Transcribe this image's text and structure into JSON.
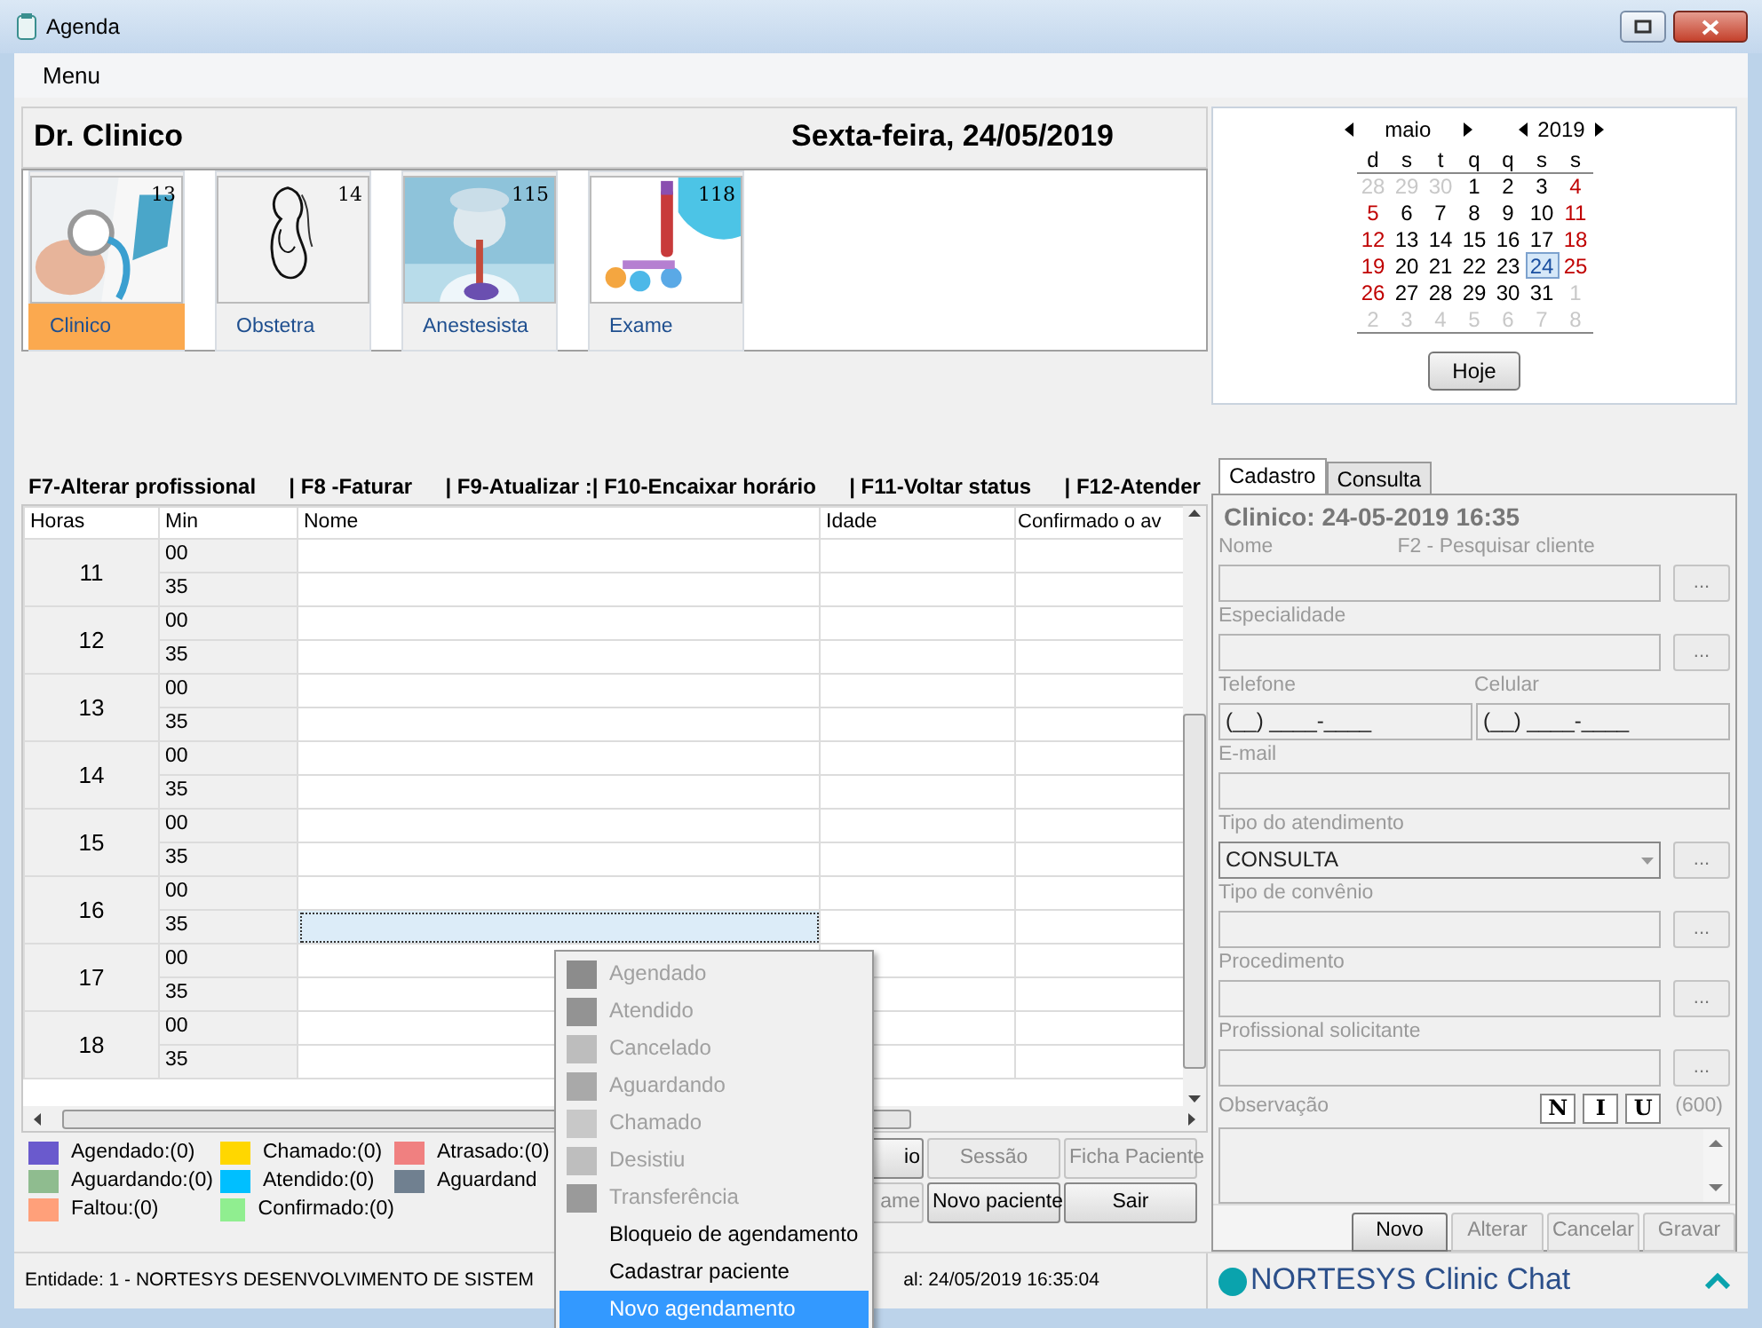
{
  "window": {
    "title": "Agenda"
  },
  "menu": [
    {
      "label": "Menu"
    }
  ],
  "header": {
    "professional": "Dr. Clinico",
    "date": "Sexta-feira, 24/05/2019"
  },
  "specialties": [
    {
      "label": "Clinico",
      "count": "13",
      "selected": true,
      "kind": "picture"
    },
    {
      "label": "Obstetra",
      "count": "14",
      "selected": false,
      "kind": "picture"
    },
    {
      "label": "Anestesista",
      "count": "115",
      "selected": false,
      "kind": "picture"
    },
    {
      "label": "Exame",
      "count": "118",
      "selected": false,
      "kind": "picture"
    }
  ],
  "shortcuts": [
    "F7-Alterar profissional",
    "| F8 -Faturar",
    "| F9-Atualizar :| F10-Encaixar horário",
    "| F11-Voltar status",
    "| F12-Atender"
  ],
  "schedule": {
    "columns": [
      "Horas",
      "Min",
      "Nome",
      "Idade",
      "Confirmado o av"
    ],
    "hours": [
      {
        "hour": "11",
        "slots": [
          {
            "min": "00",
            "selected": false
          },
          {
            "min": "35",
            "selected": false
          }
        ]
      },
      {
        "hour": "12",
        "slots": [
          {
            "min": "00",
            "selected": false
          },
          {
            "min": "35",
            "selected": false
          }
        ]
      },
      {
        "hour": "13",
        "slots": [
          {
            "min": "00",
            "selected": false
          },
          {
            "min": "35",
            "selected": false
          }
        ]
      },
      {
        "hour": "14",
        "slots": [
          {
            "min": "00",
            "selected": false
          },
          {
            "min": "35",
            "selected": false
          }
        ]
      },
      {
        "hour": "15",
        "slots": [
          {
            "min": "00",
            "selected": false
          },
          {
            "min": "35",
            "selected": false
          }
        ]
      },
      {
        "hour": "16",
        "slots": [
          {
            "min": "00",
            "selected": false
          },
          {
            "min": "35",
            "selected": true
          }
        ]
      },
      {
        "hour": "17",
        "slots": [
          {
            "min": "00",
            "selected": false
          },
          {
            "min": "35",
            "selected": false
          }
        ]
      },
      {
        "hour": "18",
        "slots": [
          {
            "min": "00",
            "selected": false
          },
          {
            "min": "35",
            "selected": false
          }
        ]
      }
    ]
  },
  "legend": [
    {
      "label": "Agendado:(0)",
      "color": "#6a5acd"
    },
    {
      "label": "Chamado:(0)",
      "color": "#ffd700"
    },
    {
      "label": "Atrasado:(0)",
      "color": "#f08080"
    },
    {
      "label": "Aguardando:(0)",
      "color": "#8fbc8f"
    },
    {
      "label": "Atendido:(0)",
      "color": "#00bfff"
    },
    {
      "label": "Aguardand",
      "color": "#708090"
    },
    {
      "label": "Faltou:(0)",
      "color": "#ffa07a"
    },
    {
      "label": "Confirmado:(0)",
      "color": "#90ee90"
    }
  ],
  "actions": [
    {
      "label": "io",
      "disabled": false
    },
    {
      "label": "Sessão",
      "disabled": true
    },
    {
      "label": "Ficha Paciente",
      "disabled": true
    },
    {
      "label": "ame",
      "disabled": true
    },
    {
      "label": "Novo paciente",
      "disabled": false
    },
    {
      "label": "Sair",
      "disabled": false
    }
  ],
  "status_bar": {
    "entity": "Entidade: 1 - NORTESYS DESENVOLVIMENTO DE SISTEM",
    "time": "al: 24/05/2019 16:35:04"
  },
  "calendar": {
    "month": "maio",
    "year": "2019",
    "weekdays": [
      "d",
      "s",
      "t",
      "q",
      "q",
      "s",
      "s"
    ],
    "weeks": [
      [
        {
          "d": "28",
          "kind": "other",
          "selected": false
        },
        {
          "d": "29",
          "kind": "other",
          "selected": false
        },
        {
          "d": "30",
          "kind": "other",
          "selected": false
        },
        {
          "d": "1",
          "kind": "weekday",
          "selected": false
        },
        {
          "d": "2",
          "kind": "weekday",
          "selected": false
        },
        {
          "d": "3",
          "kind": "weekday",
          "selected": false
        },
        {
          "d": "4",
          "kind": "weekend",
          "selected": false
        }
      ],
      [
        {
          "d": "5",
          "kind": "weekend",
          "selected": false
        },
        {
          "d": "6",
          "kind": "weekday",
          "selected": false
        },
        {
          "d": "7",
          "kind": "weekday",
          "selected": false
        },
        {
          "d": "8",
          "kind": "weekday",
          "selected": false
        },
        {
          "d": "9",
          "kind": "weekday",
          "selected": false
        },
        {
          "d": "10",
          "kind": "weekday",
          "selected": false
        },
        {
          "d": "11",
          "kind": "weekend",
          "selected": false
        }
      ],
      [
        {
          "d": "12",
          "kind": "weekend",
          "selected": false
        },
        {
          "d": "13",
          "kind": "weekday",
          "selected": false
        },
        {
          "d": "14",
          "kind": "weekday",
          "selected": false
        },
        {
          "d": "15",
          "kind": "weekday",
          "selected": false
        },
        {
          "d": "16",
          "kind": "weekday",
          "selected": false
        },
        {
          "d": "17",
          "kind": "weekday",
          "selected": false
        },
        {
          "d": "18",
          "kind": "weekend",
          "selected": false
        }
      ],
      [
        {
          "d": "19",
          "kind": "weekend",
          "selected": false
        },
        {
          "d": "20",
          "kind": "weekday",
          "selected": false
        },
        {
          "d": "21",
          "kind": "weekday",
          "selected": false
        },
        {
          "d": "22",
          "kind": "weekday",
          "selected": false
        },
        {
          "d": "23",
          "kind": "weekday",
          "selected": false
        },
        {
          "d": "24",
          "kind": "weekday",
          "selected": true
        },
        {
          "d": "25",
          "kind": "weekend",
          "selected": false
        }
      ],
      [
        {
          "d": "26",
          "kind": "weekend",
          "selected": false
        },
        {
          "d": "27",
          "kind": "weekday",
          "selected": false
        },
        {
          "d": "28",
          "kind": "weekday",
          "selected": false
        },
        {
          "d": "29",
          "kind": "weekday",
          "selected": false
        },
        {
          "d": "30",
          "kind": "weekday",
          "selected": false
        },
        {
          "d": "31",
          "kind": "weekday",
          "selected": false
        },
        {
          "d": "1",
          "kind": "other",
          "selected": false
        }
      ],
      [
        {
          "d": "2",
          "kind": "other",
          "selected": false
        },
        {
          "d": "3",
          "kind": "other",
          "selected": false
        },
        {
          "d": "4",
          "kind": "other",
          "selected": false
        },
        {
          "d": "5",
          "kind": "other",
          "selected": false
        },
        {
          "d": "6",
          "kind": "other",
          "selected": false
        },
        {
          "d": "7",
          "kind": "other",
          "selected": false
        },
        {
          "d": "8",
          "kind": "other",
          "selected": false
        }
      ]
    ],
    "today_button": "Hoje"
  },
  "tabs": [
    {
      "label": "Cadastro",
      "selected": true
    },
    {
      "label": "Consulta",
      "selected": false
    }
  ],
  "form": {
    "title": "Clinico: 24-05-2019 16:35",
    "rows": [
      {
        "kind": "lookup",
        "label": "Nome",
        "hint": "F2 - Pesquisar cliente",
        "button": "..."
      },
      {
        "kind": "lookup",
        "label": "Especialidade",
        "button": "..."
      },
      {
        "kind": "pair",
        "fields": [
          {
            "label": "Telefone",
            "value": "(__) ____-____"
          },
          {
            "label": "Celular",
            "value": "(__) ____-____"
          }
        ]
      },
      {
        "kind": "text",
        "label": "E-mail"
      },
      {
        "kind": "select",
        "label": "Tipo do atendimento",
        "value": "CONSULTA",
        "button": "..."
      },
      {
        "kind": "lookup",
        "label": "Tipo de convênio",
        "button": "..."
      },
      {
        "kind": "lookup",
        "label": "Procedimento",
        "button": "..."
      },
      {
        "kind": "lookup",
        "label": "Profissional solicitante",
        "button": "..."
      },
      {
        "kind": "memo",
        "label": "Observação",
        "format_buttons": [
          "N",
          "I",
          "U"
        ],
        "counter": "(600)"
      }
    ],
    "buttons": [
      {
        "label": "Novo",
        "disabled": false
      },
      {
        "label": "Alterar",
        "disabled": true
      },
      {
        "label": "Cancelar",
        "disabled": true
      },
      {
        "label": "Gravar",
        "disabled": true
      }
    ]
  },
  "chat": {
    "label": "NORTESYS Clinic Chat"
  },
  "context_menu": [
    {
      "label": "Agendado",
      "kind": "status",
      "color": "#8c8c8c",
      "disabled": true,
      "selected": false
    },
    {
      "label": "Atendido",
      "kind": "status",
      "color": "#939393",
      "disabled": true,
      "selected": false
    },
    {
      "label": "Cancelado",
      "kind": "status",
      "color": "#bdbdbd",
      "disabled": true,
      "selected": false
    },
    {
      "label": "Aguardando",
      "kind": "status",
      "color": "#a9a9a9",
      "disabled": true,
      "selected": false
    },
    {
      "label": "Chamado",
      "kind": "status",
      "color": "#c8c8c8",
      "disabled": true,
      "selected": false
    },
    {
      "label": "Desistiu",
      "kind": "status",
      "color": "#bebebe",
      "disabled": true,
      "selected": false
    },
    {
      "label": "Transferência",
      "kind": "status",
      "color": "#9a9a9a",
      "disabled": true,
      "selected": false
    },
    {
      "label": "Bloqueio de agendamento",
      "kind": "action",
      "disabled": false,
      "selected": false
    },
    {
      "label": "Cadastrar paciente",
      "kind": "action",
      "disabled": false,
      "selected": false
    },
    {
      "label": "Novo agendamento",
      "kind": "action",
      "disabled": false,
      "selected": true
    }
  ]
}
